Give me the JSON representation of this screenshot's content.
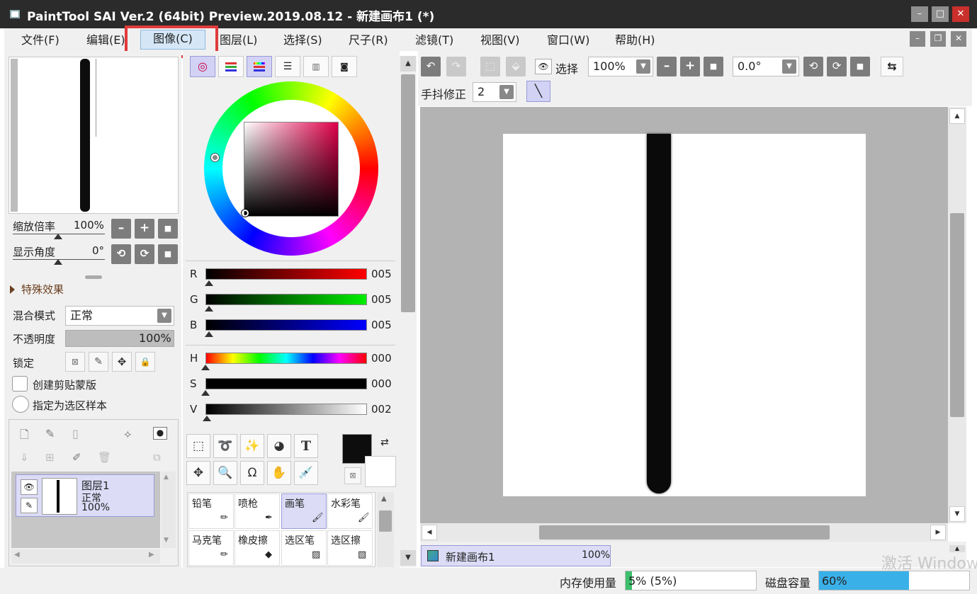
{
  "window": {
    "title": "PaintTool SAI Ver.2 (64bit) Preview.2019.08.12 - 新建画布1 (*)",
    "min": "–",
    "max": "□",
    "close": "✕"
  },
  "menu": [
    {
      "label": "文件(F)",
      "active": false
    },
    {
      "label": "编辑(E)",
      "active": false
    },
    {
      "label": "图像(C)",
      "active": true
    },
    {
      "label": "图层(L)",
      "active": false
    },
    {
      "label": "选择(S)",
      "active": false
    },
    {
      "label": "尺子(R)",
      "active": false
    },
    {
      "label": "滤镜(T)",
      "active": false
    },
    {
      "label": "视图(V)",
      "active": false
    },
    {
      "label": "窗口(W)",
      "active": false
    },
    {
      "label": "帮助(H)",
      "active": false
    }
  ],
  "mdi": {
    "min": "–",
    "restore": "❐",
    "close": "✕"
  },
  "navigator": {
    "zoom_label": "缩放倍率",
    "zoom_value": "100%",
    "angle_label": "显示角度",
    "angle_value": "0°",
    "btn_minus": "–",
    "btn_plus": "+",
    "btn_reset": "■",
    "btn_ccw": "⟲",
    "btn_cw": "⟳"
  },
  "layer_props": {
    "effects_label": "特殊效果",
    "blend_label": "混合模式",
    "blend_value": "正常",
    "opacity_label": "不透明度",
    "opacity_value": "100%",
    "lock_label": "锁定",
    "clip_label": "创建剪贴蒙版",
    "sample_label": "指定为选区样本"
  },
  "layers": [
    {
      "name": "图层1",
      "mode": "正常",
      "opacity": "100%"
    }
  ],
  "color": {
    "sliders": [
      {
        "key": "R",
        "value": "005",
        "pos": 0.02
      },
      {
        "key": "G",
        "value": "005",
        "pos": 0.02
      },
      {
        "key": "B",
        "value": "005",
        "pos": 0.02
      },
      {
        "key": "H",
        "value": "000",
        "pos": 0.0
      },
      {
        "key": "S",
        "value": "000",
        "pos": 0.0
      },
      {
        "key": "V",
        "value": "002",
        "pos": 0.01
      }
    ],
    "fg": "#0d0d0d",
    "bg": "#ffffff"
  },
  "tools": {
    "text_tool": "T",
    "brushes": [
      {
        "label": "铅笔",
        "selected": false
      },
      {
        "label": "喷枪",
        "selected": false
      },
      {
        "label": "画笔",
        "selected": true
      },
      {
        "label": "水彩笔",
        "selected": false
      },
      {
        "label": "马克笔",
        "selected": false
      },
      {
        "label": "橡皮擦",
        "selected": false
      },
      {
        "label": "选区笔",
        "selected": false
      },
      {
        "label": "选区擦",
        "selected": false
      }
    ]
  },
  "canvas_toolbar": {
    "select_label": "选择",
    "zoom_value": "100%",
    "angle_value": "0.0°",
    "stabilizer_label": "手抖修正",
    "stabilizer_value": "2"
  },
  "canvas_tab": {
    "name": "新建画布1",
    "zoom": "100%"
  },
  "status": {
    "memory_label": "内存使用量",
    "memory_value": "5% (5%)",
    "memory_fraction": 0.05,
    "disk_label": "磁盘容量",
    "disk_value": "60%",
    "disk_fraction": 0.6
  },
  "watermark": "激活 Windows"
}
